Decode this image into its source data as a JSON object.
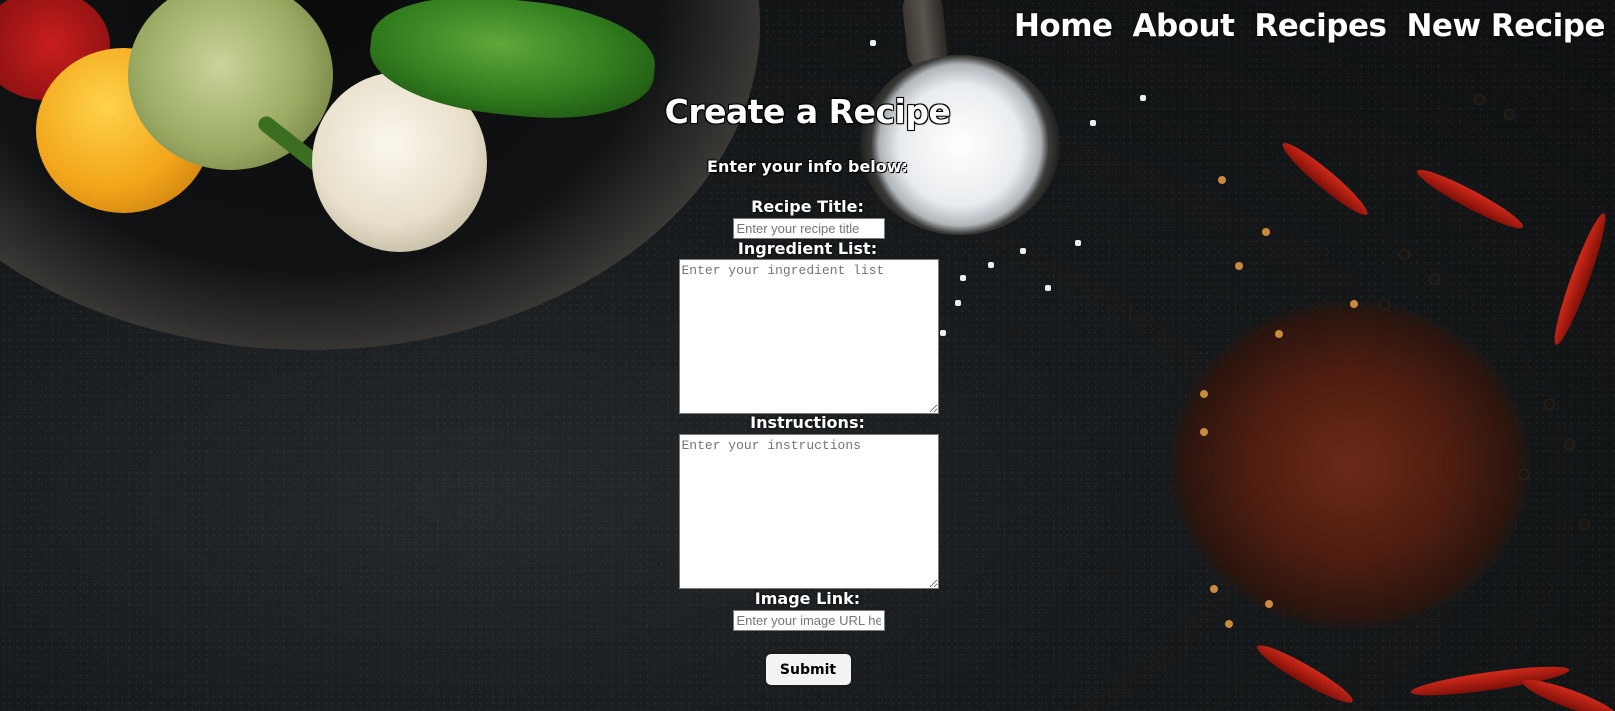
{
  "nav": {
    "items": [
      {
        "label": "Home"
      },
      {
        "label": "About"
      },
      {
        "label": "Recipes"
      },
      {
        "label": "New Recipe"
      }
    ]
  },
  "form": {
    "title": "Create a Recipe",
    "subtitle": "Enter your info below:",
    "recipe_title": {
      "label": "Recipe Title:",
      "placeholder": "Enter your recipe title",
      "value": ""
    },
    "ingredients": {
      "label": "Ingredient List:",
      "placeholder": "Enter your ingredient list",
      "value": ""
    },
    "instructions": {
      "label": "Instructions:",
      "placeholder": "Enter your instructions",
      "value": ""
    },
    "image_link": {
      "label": "Image Link:",
      "placeholder": "Enter your image URL here",
      "value": ""
    },
    "submit_label": "Submit"
  },
  "background": {
    "description_icon": "food-ingredients-background-image"
  }
}
